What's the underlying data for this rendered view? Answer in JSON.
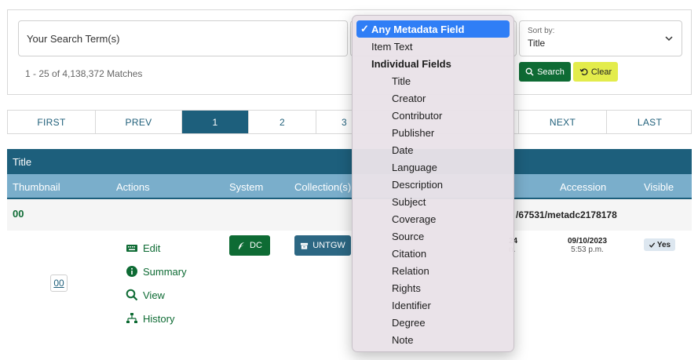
{
  "search": {
    "placeholder": "Your Search Term(s)",
    "matches": "1 - 25 of 4,138,372 Matches",
    "search_label": "Search",
    "clear_label": "Clear"
  },
  "sort": {
    "label": "Sort by:",
    "value": "Title"
  },
  "pager": {
    "items": [
      "FIRST",
      "PREV",
      "1",
      "2",
      "3",
      "NEXT",
      "LAST"
    ],
    "active": "1"
  },
  "table": {
    "header_title": "Title",
    "columns": [
      "Thumbnail",
      "Actions",
      "System",
      "Collection(s)",
      "Accession",
      "Visible"
    ],
    "row": {
      "title": "00",
      "ark_partial": "/67531/metadc2178178",
      "thumbnail_text": "00",
      "actions": [
        "Edit",
        "Summary",
        "View",
        "History"
      ],
      "system": "DC",
      "collection": "UNTGW",
      "date_partial": [
        "24",
        "n."
      ],
      "accession_date": "09/10/2023",
      "accession_time": "5:53 p.m.",
      "visible": "Yes"
    }
  },
  "dropdown": {
    "selected": "Any Metadata Field",
    "item_text": "Item Text",
    "group": "Individual Fields",
    "fields": [
      "Title",
      "Creator",
      "Contributor",
      "Publisher",
      "Date",
      "Language",
      "Description",
      "Subject",
      "Coverage",
      "Source",
      "Citation",
      "Relation",
      "Rights",
      "Identifier",
      "Degree",
      "Note"
    ]
  },
  "colors": {
    "primary": "#1d5f7c",
    "subheader": "#7aaecb",
    "success": "#0e6b34",
    "clear": "#e3ec4b",
    "select_highlight": "#2f7ef6"
  }
}
